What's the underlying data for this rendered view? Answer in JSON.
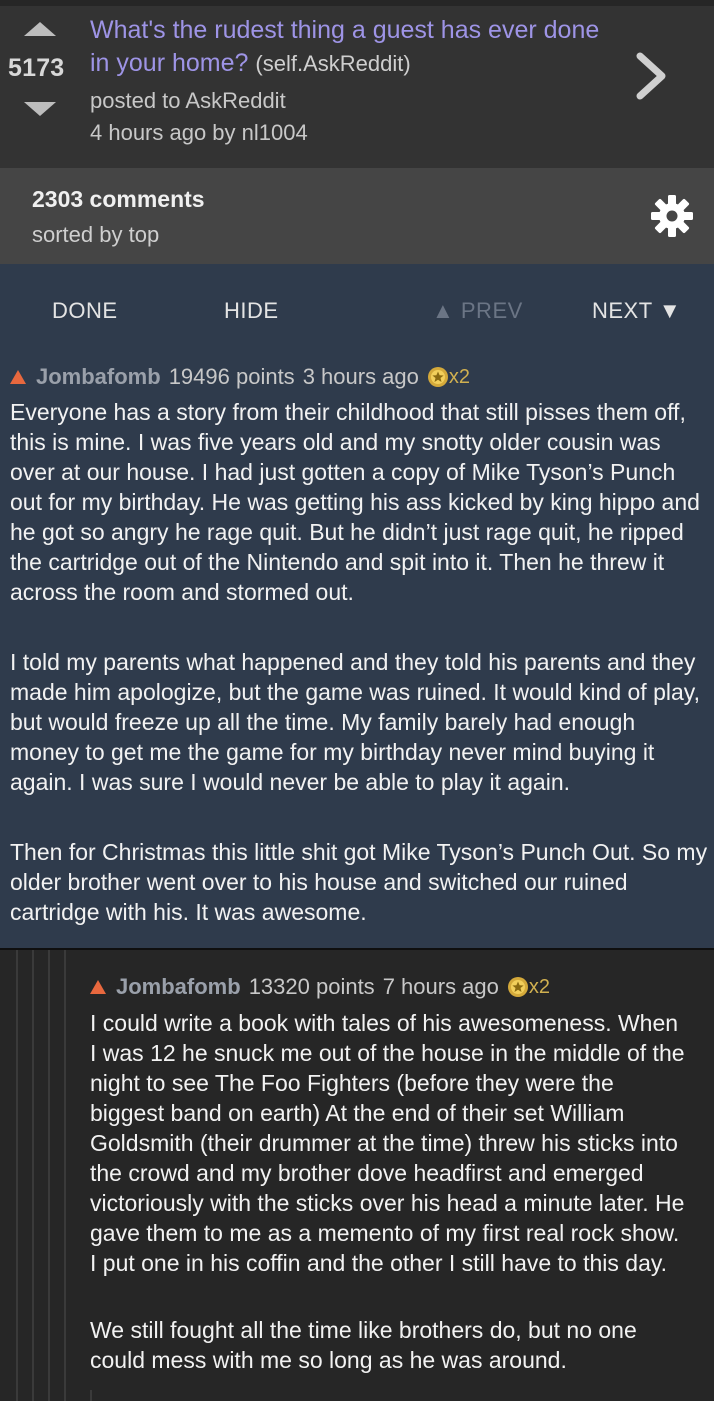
{
  "post": {
    "score": "5173",
    "title": "What's the rudest thing a guest has ever done in your home?",
    "domain": "(self.AskReddit)",
    "posted_to": "posted to AskReddit",
    "age_author": "4 hours ago by nl1004"
  },
  "comments_bar": {
    "count": "2303 comments",
    "sort": "sorted by top"
  },
  "nav": {
    "done": "DONE",
    "hide": "HIDE",
    "prev": "▲ PREV",
    "next": "NEXT ▼"
  },
  "comment1": {
    "author": "Jombafomb",
    "points": "19496 points",
    "age": "3 hours ago",
    "gilded": "x2",
    "paragraphs": [
      "Everyone has a story from their childhood that still pisses them off, this is mine. I was five years old and my snotty older cousin was over at our house. I had just gotten a copy of Mike Tyson’s Punch out for my birthday. He was getting his ass kicked by king hippo and he got so angry he rage quit. But he didn’t just rage quit, he ripped the cartridge out of the Nintendo and spit into it. Then he threw it across the room and stormed out.",
      "I told my parents what happened and they told his parents and they made him apologize, but the game was ruined. It would kind of play, but would freeze up all the time. My family barely had enough money to get me the game for my birthday never mind buying it again. I was sure I would never be able to play it again.",
      "Then for Christmas this little shit got Mike Tyson’s Punch Out. So my older brother went over to his house and switched our ruined cartridge with his. It was awesome."
    ]
  },
  "comment2": {
    "author": "Jombafomb",
    "points": "13320 points",
    "age": "7 hours ago",
    "gilded": "x2",
    "paragraphs": [
      "I could write a book with tales of his awesomeness. When I was 12 he snuck me out of the house in the middle of the night to see The Foo Fighters (before they were the biggest band on earth) At the end of their set William Goldsmith (their drummer at the time) threw his sticks into the crowd and my brother dove headfirst and emerged victoriously with the sticks over his head a minute later. He gave them to me as a memento of my first real rock show. I put one in his coffin and the other I still have to this day.",
      "We still fought all the time like brothers do, but no one could mess with me so long as he was around."
    ]
  },
  "colors": {
    "title": "#9e94e6",
    "nav_bg": "#2f3b4c",
    "upvoted": "#e8683e"
  },
  "icons": [
    "upvote-arrow-icon",
    "downvote-arrow-icon",
    "chevron-right-icon",
    "gear-icon",
    "gilded-icon"
  ]
}
